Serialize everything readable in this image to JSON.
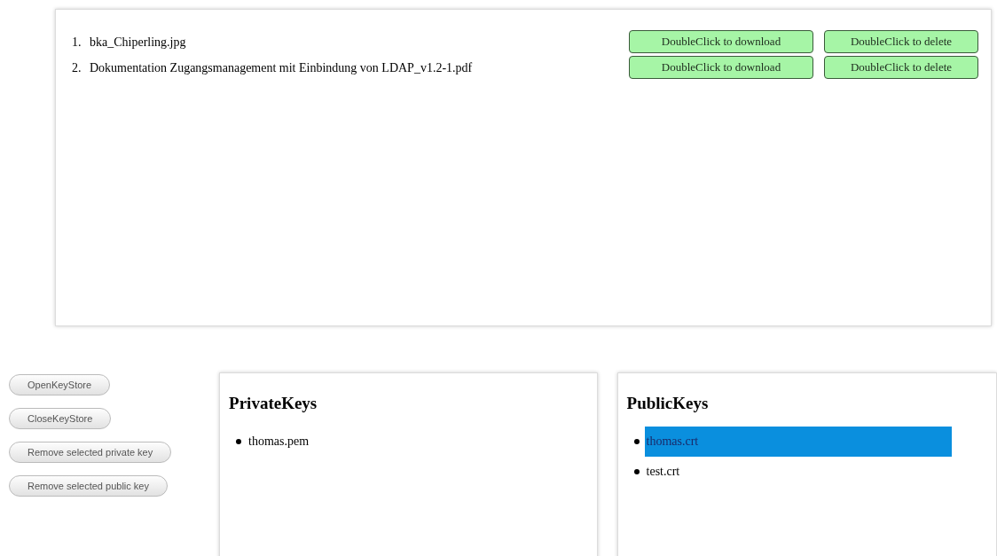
{
  "files": [
    {
      "number": "1.",
      "name": "bka_Chiperling.jpg",
      "download": "DoubleClick to download",
      "delete": "DoubleClick to delete"
    },
    {
      "number": "2.",
      "name": "Dokumentation Zugangsmanagement mit Einbindung von LDAP_v1.2-1.pdf",
      "download": "DoubleClick to download",
      "delete": "DoubleClick to delete"
    }
  ],
  "keystore_buttons": [
    "OpenKeyStore",
    "CloseKeyStore",
    "Remove selected private key",
    "Remove selected public key"
  ],
  "private_keys": {
    "title": "PrivateKeys",
    "items": [
      {
        "label": "thomas.pem",
        "selected": false
      }
    ]
  },
  "public_keys": {
    "title": "PublicKeys",
    "items": [
      {
        "label": "thomas.crt",
        "selected": true
      },
      {
        "label": "test.crt",
        "selected": false
      }
    ]
  }
}
